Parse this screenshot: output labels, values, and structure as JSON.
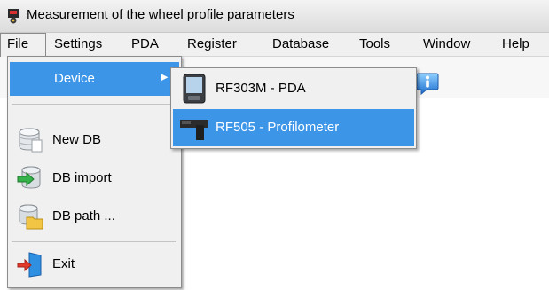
{
  "window": {
    "title": "Measurement of the wheel profile parameters",
    "icon": "wheel-gauge-icon"
  },
  "menubar": {
    "items": [
      {
        "label": "File"
      },
      {
        "label": "Settings"
      },
      {
        "label": "PDA"
      },
      {
        "label": "Register"
      },
      {
        "label": "Database"
      },
      {
        "label": "Tools"
      },
      {
        "label": "Window"
      },
      {
        "label": "Help"
      }
    ]
  },
  "file_menu": {
    "device": {
      "label": "Device",
      "icon": "chevron-right-icon"
    },
    "items": [
      {
        "label": "New DB",
        "icon": "new-database-icon"
      },
      {
        "label": "DB import",
        "icon": "import-database-icon"
      },
      {
        "label": "DB path ...",
        "icon": "database-folder-icon"
      },
      {
        "label": "Exit",
        "icon": "exit-door-icon"
      }
    ]
  },
  "device_submenu": {
    "items": [
      {
        "label": "RF303M - PDA",
        "icon": "pda-device-icon",
        "highlighted": false
      },
      {
        "label": "RF505 - Profilometer",
        "icon": "profilometer-icon",
        "highlighted": true
      }
    ]
  },
  "toolbar": {
    "info_icon": "info-icon"
  },
  "colors": {
    "highlight": "#3d95e8",
    "menu_bg": "#f0f0f0",
    "text": "#000000",
    "highlight_text": "#ffffff"
  }
}
